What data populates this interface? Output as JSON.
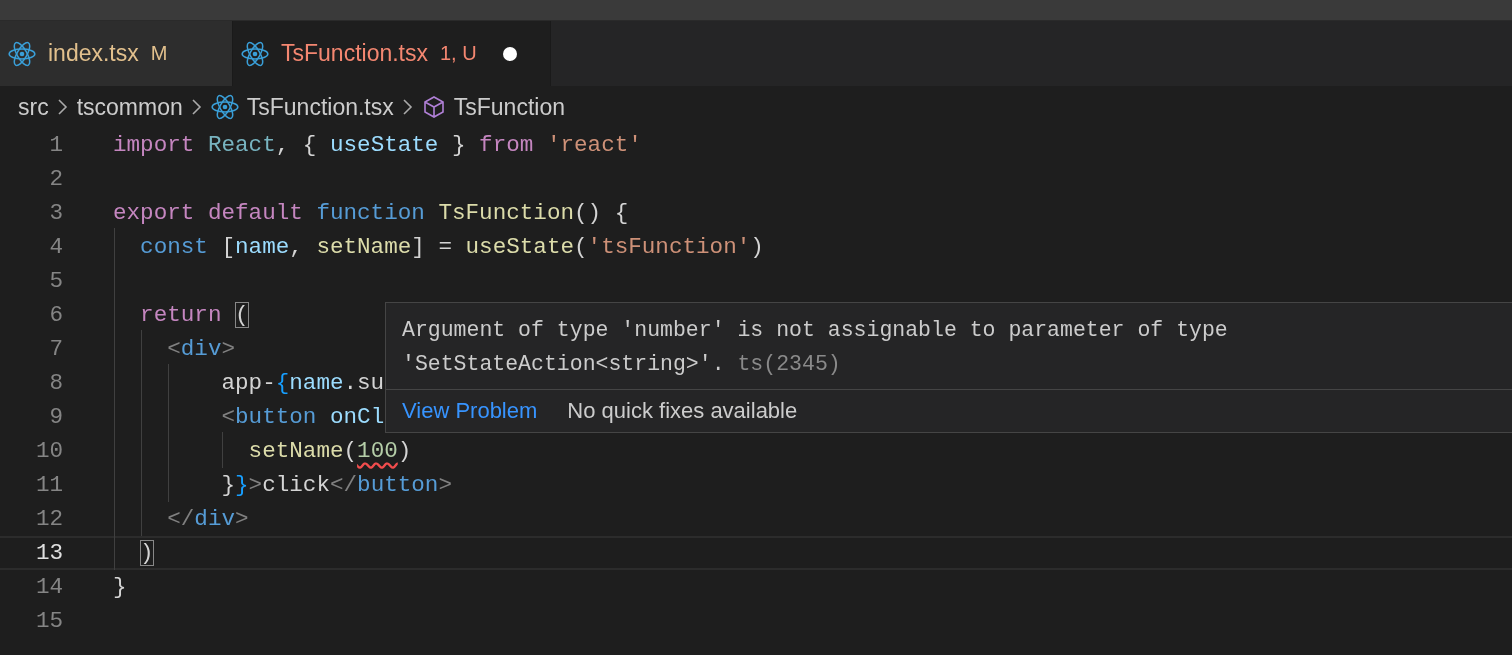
{
  "tabs": [
    {
      "label": "index.tsx",
      "badge": "M",
      "kind": "modified",
      "selected": false,
      "dirty": false
    },
    {
      "label": "TsFunction.tsx",
      "badge": "1, U",
      "kind": "error",
      "selected": true,
      "dirty": true
    }
  ],
  "breadcrumb": [
    {
      "label": "src",
      "kind": "folder"
    },
    {
      "label": "tscommon",
      "kind": "folder"
    },
    {
      "label": "TsFunction.tsx",
      "kind": "file"
    },
    {
      "label": "TsFunction",
      "kind": "symbol"
    }
  ],
  "lines": [
    {
      "number": "1",
      "current": false,
      "tokens": [
        {
          "t": "import ",
          "kind": "kw"
        },
        {
          "t": "React",
          "kind": "type"
        },
        {
          "t": ", { ",
          "kind": "p"
        },
        {
          "t": "useState",
          "kind": "var"
        },
        {
          "t": " } ",
          "kind": "p"
        },
        {
          "t": "from ",
          "kind": "kw"
        },
        {
          "t": "'react'",
          "kind": "str"
        }
      ]
    },
    {
      "number": "2",
      "current": false
    },
    {
      "number": "3",
      "current": false,
      "tokens": [
        {
          "t": "export default ",
          "kind": "kw"
        },
        {
          "t": "function ",
          "kind": "storage"
        },
        {
          "t": "TsFunction",
          "kind": "fn"
        },
        {
          "t": "() {",
          "kind": "p"
        }
      ]
    },
    {
      "number": "4",
      "current": false,
      "tokens": [
        {
          "t": "  const",
          "kind": "storage"
        },
        {
          "t": " [",
          "kind": "p"
        },
        {
          "t": "name",
          "kind": "var"
        },
        {
          "t": ", ",
          "kind": "p"
        },
        {
          "t": "setName",
          "kind": "fn"
        },
        {
          "t": "] = ",
          "kind": "p"
        },
        {
          "t": "useState",
          "kind": "fn"
        },
        {
          "t": "(",
          "kind": "p"
        },
        {
          "t": "'tsFunction'",
          "kind": "str"
        },
        {
          "t": ")",
          "kind": "p"
        }
      ]
    },
    {
      "number": "5",
      "current": false
    },
    {
      "number": "6",
      "current": false,
      "tokens": [
        {
          "t": "  return ",
          "kind": "kw"
        },
        {
          "t": "(",
          "kind": "p",
          "matched": true
        }
      ]
    },
    {
      "number": "7",
      "current": false,
      "tokens": [
        {
          "t": "    <",
          "kind": "bracket"
        },
        {
          "t": "div",
          "kind": "tag"
        },
        {
          "t": ">",
          "kind": "bracket"
        }
      ]
    },
    {
      "number": "8",
      "current": false,
      "tokens": [
        {
          "t": "        app-",
          "kind": "p"
        },
        {
          "t": "{",
          "kind": "brace"
        },
        {
          "t": "name",
          "kind": "var"
        },
        {
          "t": ".su",
          "kind": "p"
        }
      ]
    },
    {
      "number": "9",
      "current": false,
      "tokens": [
        {
          "t": "        <",
          "kind": "bracket"
        },
        {
          "t": "button ",
          "kind": "tag"
        },
        {
          "t": "onCl",
          "kind": "var"
        }
      ]
    },
    {
      "number": "10",
      "current": false,
      "tokens": [
        {
          "t": "          setName",
          "kind": "fn"
        },
        {
          "t": "(",
          "kind": "p"
        },
        {
          "t": "100",
          "kind": "num",
          "error": true
        },
        {
          "t": ")",
          "kind": "p"
        }
      ]
    },
    {
      "number": "11",
      "current": false,
      "tokens": [
        {
          "t": "        }",
          "kind": "p"
        },
        {
          "t": "}",
          "kind": "brace"
        },
        {
          "t": ">",
          "kind": "bracket"
        },
        {
          "t": "click",
          "kind": "p"
        },
        {
          "t": "</",
          "kind": "bracket"
        },
        {
          "t": "button",
          "kind": "tag"
        },
        {
          "t": ">",
          "kind": "bracket"
        }
      ]
    },
    {
      "number": "12",
      "current": false,
      "tokens": [
        {
          "t": "    </",
          "kind": "bracket"
        },
        {
          "t": "div",
          "kind": "tag"
        },
        {
          "t": ">",
          "kind": "bracket"
        }
      ]
    },
    {
      "number": "13",
      "current": true,
      "tokens": [
        {
          "t": "  )",
          "kind": "p",
          "matched": true
        }
      ]
    },
    {
      "number": "14",
      "current": false,
      "tokens": [
        {
          "t": "}",
          "kind": "p"
        }
      ]
    },
    {
      "number": "15",
      "current": false
    }
  ],
  "hover": {
    "message": [
      "Argument of type 'number' is not assignable to parameter of type",
      "'SetStateAction<string>'."
    ],
    "code": "ts(2345)",
    "link": "View Problem",
    "note": "No quick fixes available"
  }
}
